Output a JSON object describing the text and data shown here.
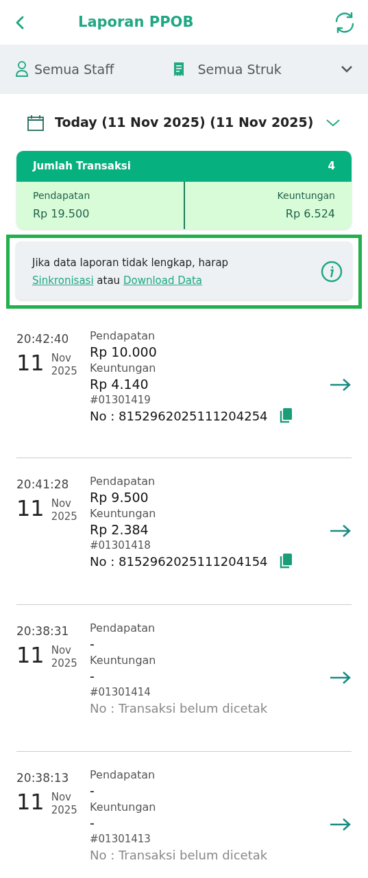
{
  "header": {
    "title": "Laporan PPOB"
  },
  "filters": {
    "staff": "Semua Staff",
    "receipt": "Semua Struk"
  },
  "date_range": "Today (11 Nov 2025) (11 Nov 2025)",
  "summary": {
    "title": "Jumlah Transaksi",
    "count": "4",
    "income_label": "Pendapatan",
    "income": "Rp 19.500",
    "profit_label": "Keuntungan",
    "profit": "Rp 6.524"
  },
  "notice": {
    "highlighted": true,
    "text": "Jika data laporan tidak lengkap, harap",
    "link_sync": "Sinkronisasi",
    "connector": "atau",
    "link_download": "Download Data"
  },
  "transactions": [
    {
      "time": "20:42:40",
      "day": "11",
      "month": "Nov",
      "year": "2025",
      "income_label": "Pendapatan",
      "income": "Rp 10.000",
      "profit_label": "Keuntungan",
      "profit": "Rp 4.140",
      "ref": "#01301419",
      "number": "No : 8152962025111204254",
      "printed": true
    },
    {
      "time": "20:41:28",
      "day": "11",
      "month": "Nov",
      "year": "2025",
      "income_label": "Pendapatan",
      "income": "Rp 9.500",
      "profit_label": "Keuntungan",
      "profit": "Rp 2.384",
      "ref": "#01301418",
      "number": "No : 8152962025111204154",
      "printed": true
    },
    {
      "time": "20:38:31",
      "day": "11",
      "month": "Nov",
      "year": "2025",
      "income_label": "Pendapatan",
      "income": "-",
      "profit_label": "Keuntungan",
      "profit": "-",
      "ref": "#01301414",
      "number": "No : Transaksi belum dicetak",
      "printed": false
    },
    {
      "time": "20:38:13",
      "day": "11",
      "month": "Nov",
      "year": "2025",
      "income_label": "Pendapatan",
      "income": "-",
      "profit_label": "Keuntungan",
      "profit": "-",
      "ref": "#01301413",
      "number": "No : Transaksi belum dicetak",
      "printed": false
    }
  ]
}
